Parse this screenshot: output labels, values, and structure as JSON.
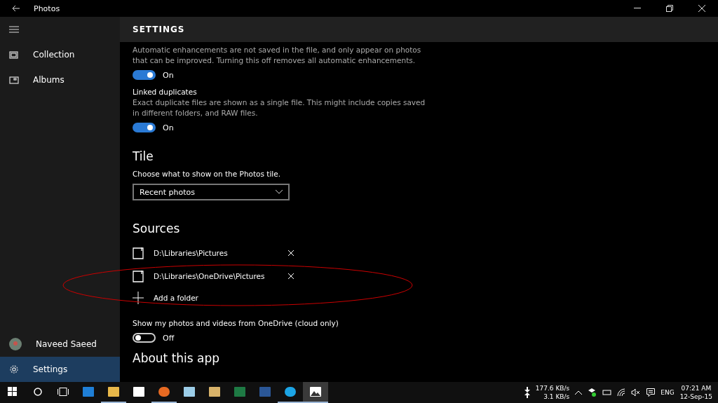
{
  "window": {
    "title": "Photos"
  },
  "sidebar": {
    "items": [
      {
        "label": "Collection",
        "kind": "collection",
        "selected": false
      },
      {
        "label": "Albums",
        "kind": "albums",
        "selected": false
      }
    ],
    "bottom_items": [
      {
        "label": "Naveed Saeed",
        "kind": "avatar",
        "selected": false
      },
      {
        "label": "Settings",
        "kind": "settings",
        "selected": true
      }
    ]
  },
  "header": "SETTINGS",
  "enhance": {
    "description": "Automatic enhancements are not saved in the file, and only appear on photos that can be improved. Turning this off removes all automatic enhancements.",
    "on": true,
    "state_label": "On"
  },
  "linked": {
    "title": "Linked duplicates",
    "description": "Exact duplicate files are shown as a single file. This might include copies saved in different folders, and RAW files.",
    "on": true,
    "state_label": "On"
  },
  "tile": {
    "heading": "Tile",
    "prompt": "Choose what to show on the Photos tile.",
    "value": "Recent photos"
  },
  "sources": {
    "heading": "Sources",
    "folders": [
      "D:\\Libraries\\Pictures",
      "D:\\Libraries\\OneDrive\\Pictures"
    ],
    "add_label": "Add a folder"
  },
  "onedrive": {
    "title": "Show my photos and videos from OneDrive (cloud only)",
    "on": false,
    "state_label": "Off"
  },
  "about_heading": "About this app",
  "taskbar": {
    "apps": [
      {
        "kind": "edge",
        "running": false,
        "selected": false
      },
      {
        "kind": "explorer",
        "running": true,
        "selected": false
      },
      {
        "kind": "store",
        "running": false,
        "selected": false
      },
      {
        "kind": "firefox",
        "running": true,
        "selected": false
      },
      {
        "kind": "notepad",
        "running": false,
        "selected": false
      },
      {
        "kind": "mail",
        "running": false,
        "selected": false
      },
      {
        "kind": "excel",
        "running": false,
        "selected": false
      },
      {
        "kind": "word",
        "running": false,
        "selected": false
      },
      {
        "kind": "skype",
        "running": true,
        "selected": false
      },
      {
        "kind": "photos",
        "running": true,
        "selected": true
      }
    ],
    "download": "177.6 KB/s",
    "upload": "3.1 KB/s",
    "language": "ENG",
    "time": "07:21 AM",
    "date": "12-Sep-15"
  }
}
